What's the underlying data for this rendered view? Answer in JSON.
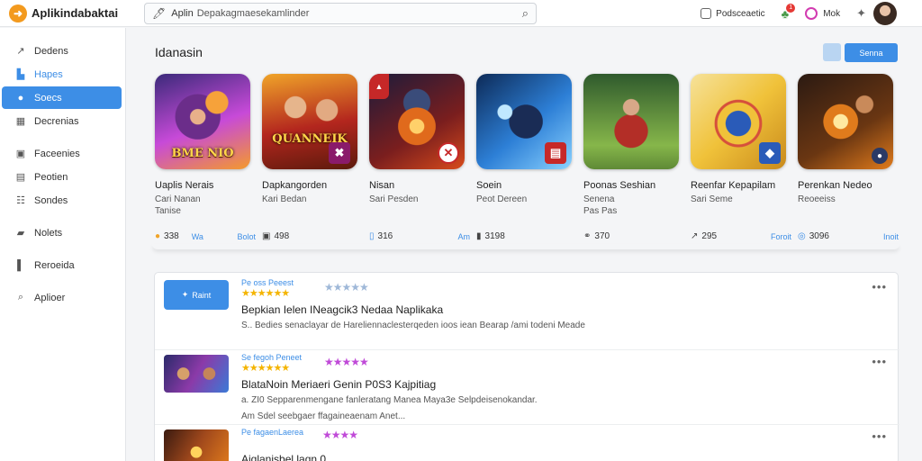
{
  "app": {
    "title": "Aplikindabaktai"
  },
  "search": {
    "app_label": "Aplin",
    "value": "Depakagmaesekamlinder"
  },
  "topbar": {
    "notifications_label": "Podsceaetic",
    "bell_badge": "1",
    "mode_label": "Mok"
  },
  "sidebar": {
    "items": [
      {
        "label": "Dedens",
        "icon": "trend-icon"
      },
      {
        "label": "Hapes",
        "icon": "chart-icon"
      },
      {
        "label": "Soecs",
        "icon": "apps-icon",
        "active": true
      },
      {
        "label": "Decrenias",
        "icon": "grid-icon"
      },
      {
        "label": "Faceenies",
        "icon": "square-icon"
      },
      {
        "label": "Peotien",
        "icon": "window-icon"
      },
      {
        "label": "Sondes",
        "icon": "list-icon"
      },
      {
        "label": "Nolets",
        "icon": "folder-icon"
      },
      {
        "label": "Reroeida",
        "icon": "bar-icon"
      },
      {
        "label": "Aplioer",
        "icon": "search-icon"
      }
    ]
  },
  "main": {
    "section_title": "Idanasin",
    "primary_button": "Senna"
  },
  "cards": [
    {
      "title": "Uaplis Nerais",
      "sub": "Cari Nanan",
      "sub2": "Tanise",
      "count": "338",
      "tag": "Bolot",
      "tag2": "Wa",
      "tile_text": "BME NIO",
      "colors": [
        "#3b2a7a",
        "#c74ad8",
        "#f49a2c"
      ]
    },
    {
      "title": "Dapkangorden",
      "sub": "Kari Bedan",
      "sub2": "",
      "count": "498",
      "tag": "",
      "tag2": "",
      "tile_text": "QUANNEIK",
      "colors": [
        "#b3261e",
        "#f0a429",
        "#5c1a0c"
      ]
    },
    {
      "title": "Nisan",
      "sub": "Sari Pesden",
      "sub2": "",
      "count": "",
      "tag": "",
      "tag2": "",
      "tile_text": "",
      "colors": [
        "#1c1b3b",
        "#d84b1b",
        "#f2a23b"
      ]
    },
    {
      "title": "Soein",
      "sub": "Peot Dereen",
      "sub2": "",
      "count": "316",
      "tag": "Am",
      "tag2": "",
      "tile_text": "",
      "colors": [
        "#0d2a57",
        "#2d7fd6",
        "#8ad2ff"
      ]
    },
    {
      "title": "Poonas Seshian",
      "sub": "Senena",
      "sub2": "Pas Pas",
      "count": "3198",
      "tag": "",
      "tag2": "",
      "tile_text": "",
      "colors": [
        "#2f5a2d",
        "#86b64a",
        "#b32e27"
      ]
    },
    {
      "title": "Reenfar Kepapilam",
      "sub": "Sari Seme",
      "sub2": "",
      "count": "370",
      "tag": "",
      "tag2": "",
      "tile_text": "",
      "colors": [
        "#f0c23a",
        "#2a5bb8",
        "#d6503b"
      ]
    },
    {
      "title": "Perenkan Nedeo",
      "sub": "Reoeeiss",
      "sub2": "",
      "count": "295",
      "tag": "Foroit",
      "tag2": "",
      "tile_text": "",
      "colors": [
        "#2b1a12",
        "#e07b1c",
        "#ffd35c"
      ]
    }
  ],
  "extra_card": {
    "count": "3096",
    "tag": "Inoit"
  },
  "list": [
    {
      "meta": "Pe oss Peeest",
      "thumb_label": "Raint",
      "thumb_type": "blue",
      "title": "Bepkian Ielen INeagcik3 Nedaa Naplikaka",
      "desc": "S.. Bedies senaclayar de Hareliennaclesterqeden ioos iean Bearap /ami todeni Meade",
      "desc2": "",
      "stars_secondary": "★★★★★"
    },
    {
      "meta": "Se fegoh Peneet",
      "thumb_label": "",
      "thumb_type": "art",
      "title": "BlataNoin Meriaeri Genin P0S3 Kajpitiag",
      "desc": "a. ZI0 Sepparenmengane fanleratang Manea Maya3e Selpdeisenokandar.",
      "desc2": "Am Sdel seebgaer ffagaineaenam Anet...",
      "stars_secondary": "★★★★★"
    },
    {
      "meta": "Pe fagaenLaerea",
      "thumb_label": "",
      "thumb_type": "art2",
      "title": "Aiqlanisbel laqn 0",
      "desc": "",
      "desc2": "",
      "stars_secondary": "★★★★"
    }
  ],
  "more_label": "•••"
}
